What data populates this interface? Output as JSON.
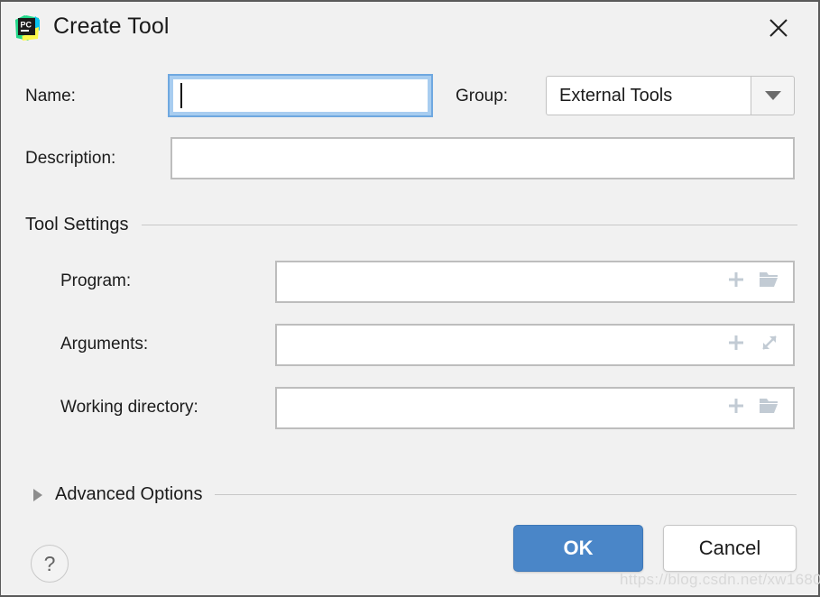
{
  "window": {
    "title": "Create Tool",
    "app_icon": "pycharm-icon",
    "close_icon": "close-icon",
    "background": "#f1f1f1",
    "border_color": "#5a5a5a"
  },
  "form": {
    "name": {
      "label": "Name:",
      "value": "",
      "placeholder": "",
      "focused": true,
      "focus_ring_color": "#a8cdf0"
    },
    "group": {
      "label": "Group:",
      "value": "External Tools",
      "dropdown_icon": "chevron-down-icon"
    },
    "description": {
      "label": "Description:",
      "value": "",
      "placeholder": ""
    }
  },
  "tool_settings": {
    "title": "Tool Settings",
    "fields": [
      {
        "key": "program",
        "label": "Program:",
        "value": "",
        "placeholder": "",
        "icons": [
          "plus-icon",
          "folder-icon"
        ]
      },
      {
        "key": "arguments",
        "label": "Arguments:",
        "value": "",
        "placeholder": "",
        "icons": [
          "plus-icon",
          "expand-icon"
        ]
      },
      {
        "key": "working_directory",
        "label": "Working directory:",
        "value": "",
        "placeholder": "",
        "icons": [
          "plus-icon",
          "folder-icon"
        ]
      }
    ]
  },
  "advanced_options": {
    "title": "Advanced Options",
    "expanded": false,
    "toggle_icon": "triangle-right-icon"
  },
  "buttons": {
    "help": {
      "label": "?",
      "icon": "help-icon"
    },
    "ok": {
      "label": "OK",
      "color": "#4a86c8",
      "text_color": "#ffffff"
    },
    "cancel": {
      "label": "Cancel",
      "color": "#ffffff",
      "text_color": "#1b1b1b"
    }
  },
  "watermark": {
    "text": "https://blog.csdn.net/xw1680"
  }
}
